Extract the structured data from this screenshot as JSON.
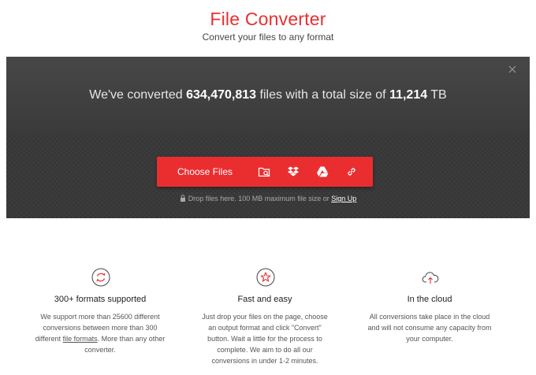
{
  "header": {
    "title": "File Converter",
    "subtitle": "Convert your files to any format"
  },
  "stats": {
    "prefix": "We've converted",
    "file_count": "634,470,813",
    "middle": "files with a total size of",
    "total_size": "11,214",
    "unit": "TB"
  },
  "upload": {
    "choose_label": "Choose Files",
    "drop_text": "Drop files here. 100 MB maximum file size or",
    "signup_label": "Sign Up"
  },
  "features": [
    {
      "icon": "refresh-circle-icon",
      "title": "300+ formats supported",
      "text_before": "We support more than 25600 different conversions between more than 300 different",
      "link": "file formats",
      "text_after": ". More than any other converter."
    },
    {
      "icon": "star-circle-icon",
      "title": "Fast and easy",
      "text": "Just drop your files on the page, choose an output format and click \"Convert\" button. Wait a little for the process to complete. We aim to do all our conversions in under 1-2 minutes."
    },
    {
      "icon": "cloud-upload-icon",
      "title": "In the cloud",
      "text": "All conversions take place in the cloud and will not consume any capacity from your computer."
    }
  ],
  "colors": {
    "brand": "#ea2e30",
    "hero_bg": "#464646"
  }
}
